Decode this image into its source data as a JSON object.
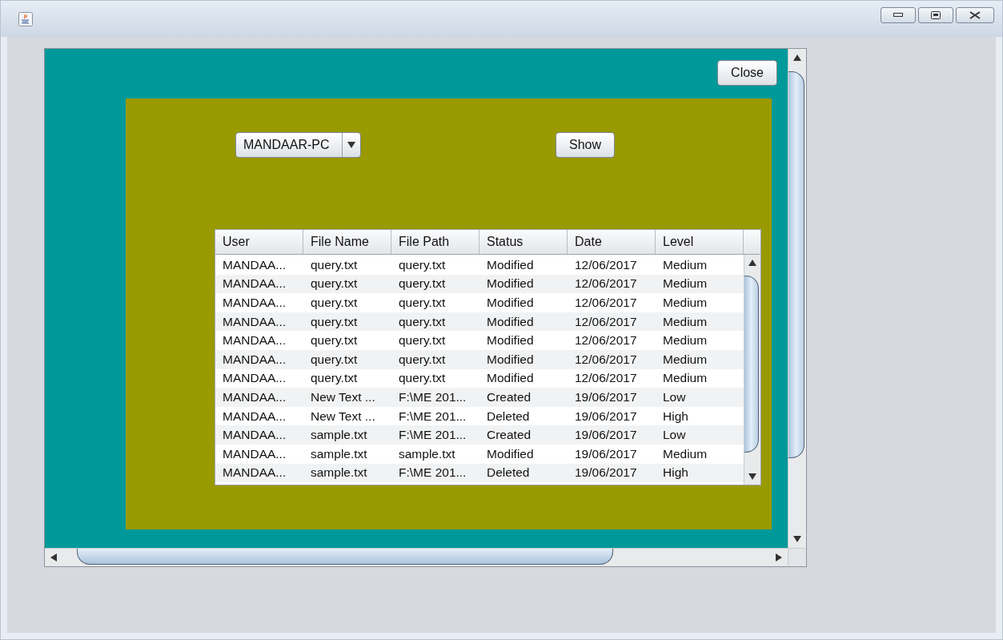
{
  "close_button": {
    "label": "Close"
  },
  "combo": {
    "value": "MANDAAR-PC"
  },
  "show_button": {
    "label": "Show"
  },
  "table": {
    "columns": [
      "User",
      "File Name",
      "File Path",
      "Status",
      "Date",
      "Level"
    ],
    "rows": [
      [
        "MANDAA...",
        "query.txt",
        "query.txt",
        "Modified",
        "12/06/2017",
        "Medium"
      ],
      [
        "MANDAA...",
        "query.txt",
        "query.txt",
        "Modified",
        "12/06/2017",
        "Medium"
      ],
      [
        "MANDAA...",
        "query.txt",
        "query.txt",
        "Modified",
        "12/06/2017",
        "Medium"
      ],
      [
        "MANDAA...",
        "query.txt",
        "query.txt",
        "Modified",
        "12/06/2017",
        "Medium"
      ],
      [
        "MANDAA...",
        "query.txt",
        "query.txt",
        "Modified",
        "12/06/2017",
        "Medium"
      ],
      [
        "MANDAA...",
        "query.txt",
        "query.txt",
        "Modified",
        "12/06/2017",
        "Medium"
      ],
      [
        "MANDAA...",
        "query.txt",
        "query.txt",
        "Modified",
        "12/06/2017",
        "Medium"
      ],
      [
        "MANDAA...",
        "New Text ...",
        "F:\\ME 201...",
        "Created",
        "19/06/2017",
        "Low"
      ],
      [
        "MANDAA...",
        "New Text ...",
        "F:\\ME 201...",
        "Deleted",
        "19/06/2017",
        "High"
      ],
      [
        "MANDAA...",
        "sample.txt",
        "F:\\ME 201...",
        "Created",
        "19/06/2017",
        "Low"
      ],
      [
        "MANDAA...",
        "sample.txt",
        "sample.txt",
        "Modified",
        "19/06/2017",
        "Medium"
      ],
      [
        "MANDAA...",
        "sample.txt",
        "F:\\ME 201...",
        "Deleted",
        "19/06/2017",
        "High"
      ]
    ]
  }
}
